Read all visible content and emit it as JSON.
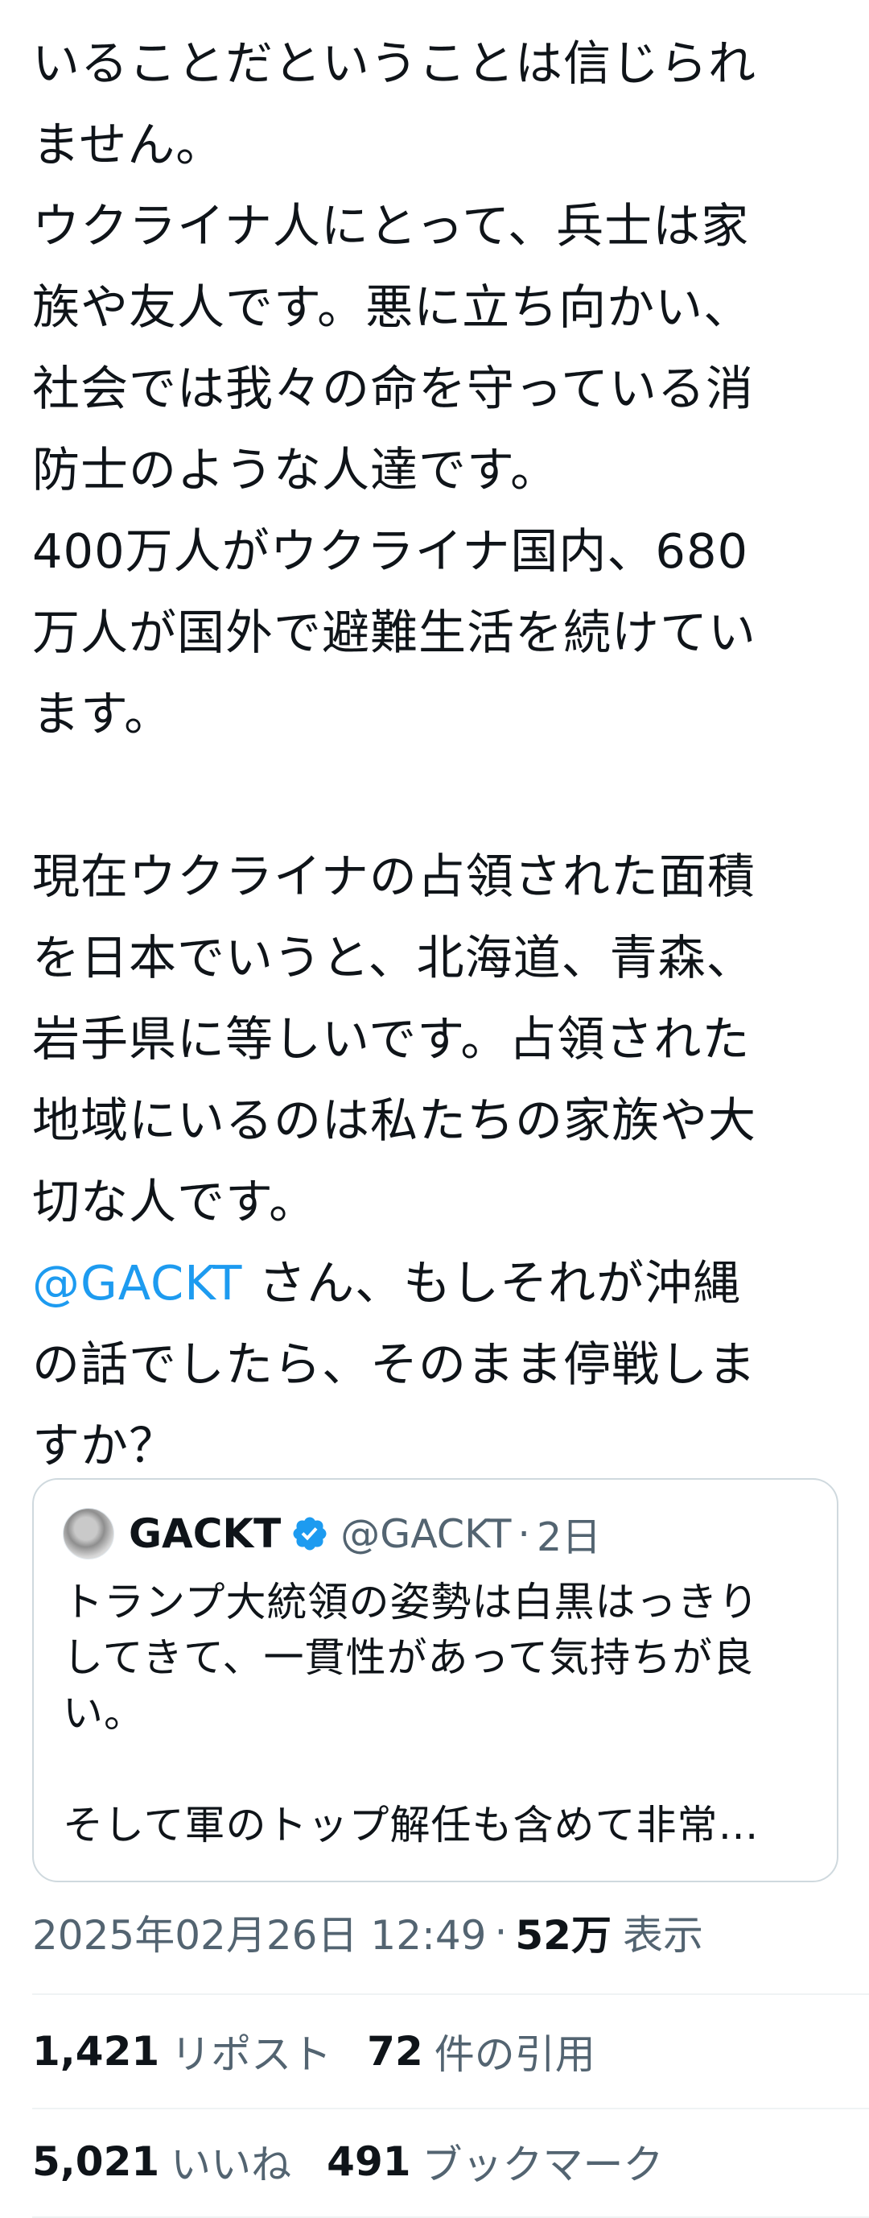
{
  "tweet": {
    "lines": [
      "いることだということは信じられ",
      "ません。",
      "ウクライナ人にとって、兵士は家",
      "族や友人です。悪に立ち向かい、",
      "社会では我々の命を守っている消",
      "防士のような人達です。",
      "400万人がウクライナ国内、680",
      "万人が国外で避難生活を続けてい",
      "ます。",
      "",
      "現在ウクライナの占領された面積",
      "を日本でいうと、北海道、青森、",
      "岩手県に等しいです。占領された",
      "地域にいるのは私たちの家族や大",
      "切な人です。"
    ],
    "mention": "@GACKT",
    "mention_rest": " さん、もしそれが沖縄",
    "after_lines": [
      "の話でしたら、そのまま停戦しま",
      "すか？"
    ]
  },
  "quote": {
    "name": "GACKT",
    "handle": "@GACKT",
    "separator": "·",
    "time": "2日",
    "lines": [
      "トランプ大統領の姿勢は白黒はっきり",
      "してきて、一貫性があって気持ちが良",
      "い。",
      "",
      "そして軍のトップ解任も含めて非常…"
    ]
  },
  "meta": {
    "datetime": "2025年02月26日 12:49",
    "separator": "·",
    "views_count": "52万",
    "views_label": "表示"
  },
  "stats": {
    "reposts_count": "1,421",
    "reposts_label": "リポスト",
    "quotes_count": "72",
    "quotes_label": "件の引用",
    "likes_count": "5,021",
    "likes_label": "いいね",
    "bookmarks_count": "491",
    "bookmarks_label": "ブックマーク"
  },
  "colors": {
    "text": "#0f1419",
    "secondary": "#536471",
    "link": "#1d9bf0",
    "verified": "#1d9bf0",
    "border": "#cfd9de"
  },
  "icons": {
    "verified": "verified-badge-icon",
    "avatar": "avatar"
  }
}
